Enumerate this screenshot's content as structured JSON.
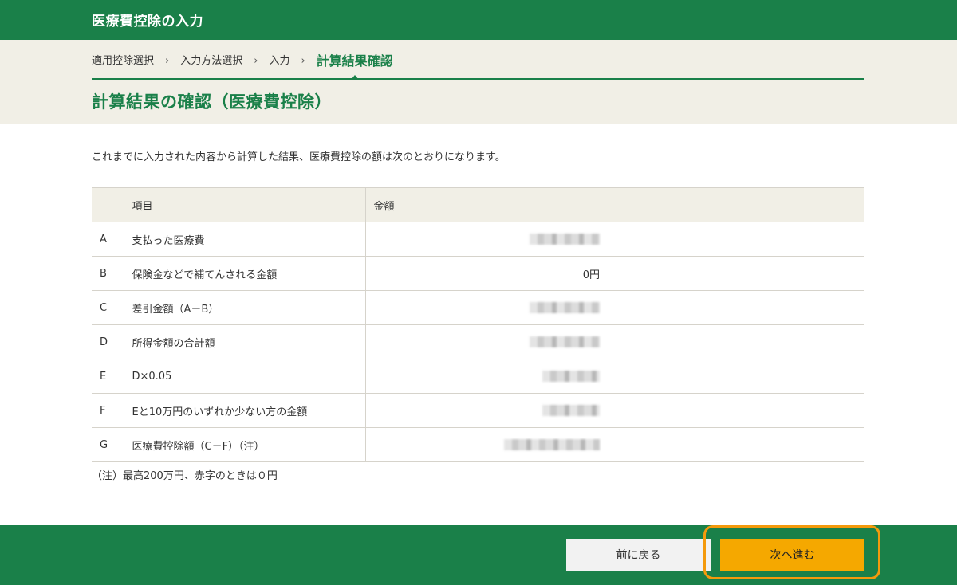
{
  "topbar": {
    "title": "医療費控除の入力"
  },
  "breadcrumb": {
    "steps": [
      "適用控除選択",
      "入力方法選択",
      "入力",
      "計算結果確認"
    ],
    "separator": "›"
  },
  "page_title": "計算結果の確認（医療費控除）",
  "intro": "これまでに入力された内容から計算した結果、医療費控除の額は次のとおりになります。",
  "table": {
    "headers": [
      "",
      "項目",
      "金額"
    ],
    "rows": [
      {
        "key": "A",
        "item": "支払った医療費",
        "amount": ""
      },
      {
        "key": "B",
        "item": "保険金などで補てんされる金額",
        "amount": "0円"
      },
      {
        "key": "C",
        "item": "差引金額（A－B）",
        "amount": ""
      },
      {
        "key": "D",
        "item": "所得金額の合計額",
        "amount": ""
      },
      {
        "key": "E",
        "item": "D×0.05",
        "amount": ""
      },
      {
        "key": "F",
        "item": "Eと10万円のいずれか少ない方の金額",
        "amount": ""
      },
      {
        "key": "G",
        "item": "医療費控除額（C－F）（注）",
        "amount": ""
      }
    ]
  },
  "note": "（注）最高200万円、赤字のときは０円",
  "footer": {
    "back_label": "前に戻る",
    "next_label": "次へ進む"
  },
  "colors": {
    "brand_green": "#1a8049",
    "band_beige": "#f1efe6",
    "next_button": "#f5a800",
    "highlight": "#f49a0c"
  }
}
